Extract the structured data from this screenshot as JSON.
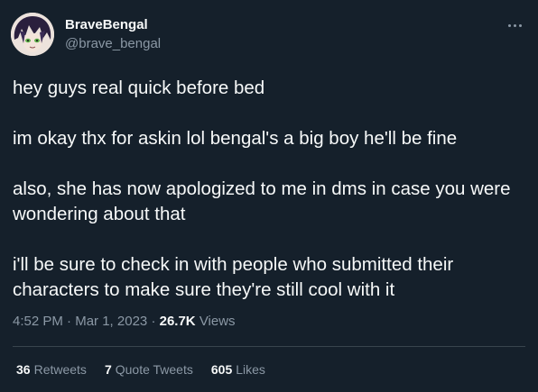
{
  "author": {
    "display_name": "BraveBengal",
    "handle": "@brave_bengal",
    "avatar_icon": "anime-character-avatar"
  },
  "tweet": {
    "paragraphs": [
      "hey guys real quick before bed",
      "im okay thx for askin lol bengal's a big boy he'll be fine",
      "also, she has now apologized to me in dms in case you were wondering about that",
      "i'll be sure to check in with people who submitted their characters to make sure they're still cool with it"
    ]
  },
  "meta": {
    "time": "4:52 PM",
    "separator": "·",
    "date": "Mar 1, 2023",
    "views_count": "26.7K",
    "views_label": "Views"
  },
  "stats": {
    "retweets_count": "36",
    "retweets_label": "Retweets",
    "quotes_count": "7",
    "quotes_label": "Quote Tweets",
    "likes_count": "605",
    "likes_label": "Likes"
  },
  "colors": {
    "background": "#15202b",
    "text_primary": "#f7f9f9",
    "text_secondary": "#8b98a5",
    "divider": "#38444d"
  }
}
